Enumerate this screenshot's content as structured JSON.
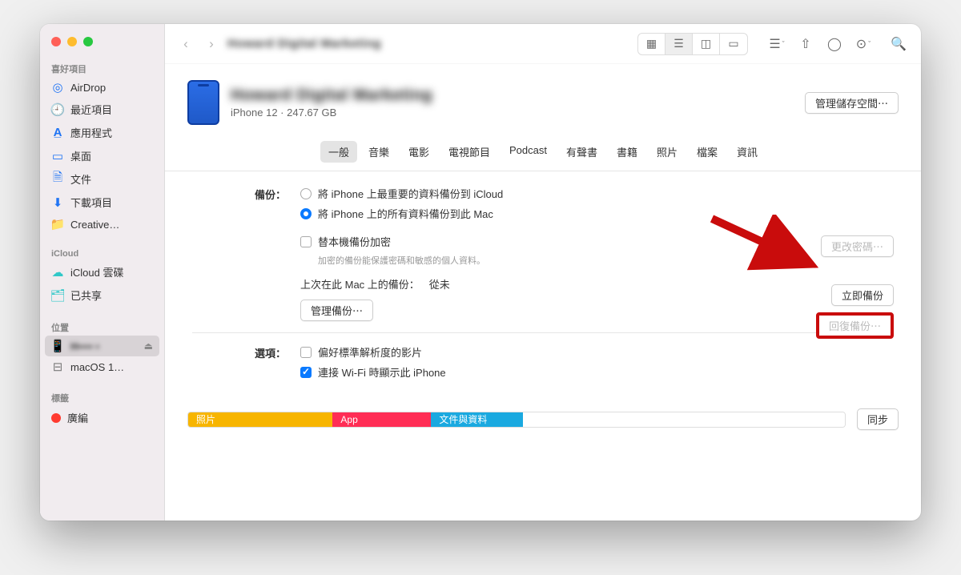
{
  "window_title": "Howard Digital Marketing",
  "sidebar": {
    "favorites_header": "喜好項目",
    "items": [
      {
        "icon": "airdrop",
        "label": "AirDrop"
      },
      {
        "icon": "recent",
        "label": "最近項目"
      },
      {
        "icon": "apps",
        "label": "應用程式"
      },
      {
        "icon": "desktop",
        "label": "桌面"
      },
      {
        "icon": "documents",
        "label": "文件"
      },
      {
        "icon": "downloads",
        "label": "下載項目"
      },
      {
        "icon": "folder",
        "label": "Creative…"
      }
    ],
    "icloud_header": "iCloud",
    "icloud_items": [
      {
        "icon": "cloud",
        "label": "iCloud 雲碟"
      },
      {
        "icon": "shared",
        "label": "已共享"
      }
    ],
    "locations_header": "位置",
    "location_items": [
      {
        "icon": "phone",
        "label": "H···· ▪",
        "ejectable": true
      },
      {
        "icon": "disk",
        "label": "macOS 1…"
      }
    ],
    "tags_header": "標籤",
    "tag_items": [
      {
        "color": "#ff3b30",
        "label": "廣編"
      }
    ]
  },
  "device": {
    "name": "Howard Digital Marketing",
    "model": "iPhone 12",
    "capacity": "247.67 GB",
    "manage_storage": "管理儲存空間⋯"
  },
  "tabs": [
    "一般",
    "音樂",
    "電影",
    "電視節目",
    "Podcast",
    "有聲書",
    "書籍",
    "照片",
    "檔案",
    "資訊"
  ],
  "active_tab": 0,
  "backup": {
    "section_label": "備份：",
    "opt_icloud": "將 iPhone 上最重要的資料備份到 iCloud",
    "opt_mac": "將 iPhone 上的所有資料備份到此 Mac",
    "encrypt_label": "替本機備份加密",
    "encrypt_hint": "加密的備份能保護密碼和敏感的個人資料。",
    "change_pw": "更改密碼⋯",
    "last_backup_label": "上次在此 Mac 上的備份：",
    "last_backup_value": "從未",
    "manage_backups": "管理備份⋯",
    "backup_now": "立即備份",
    "restore": "回復備份⋯"
  },
  "options": {
    "section_label": "選項：",
    "prefer_sd": "偏好標準解析度的影片",
    "wifi_sync": "連接 Wi-Fi 時顯示此 iPhone"
  },
  "storage": {
    "photos": "照片",
    "app": "App",
    "docs": "文件與資料",
    "sync": "同步"
  }
}
